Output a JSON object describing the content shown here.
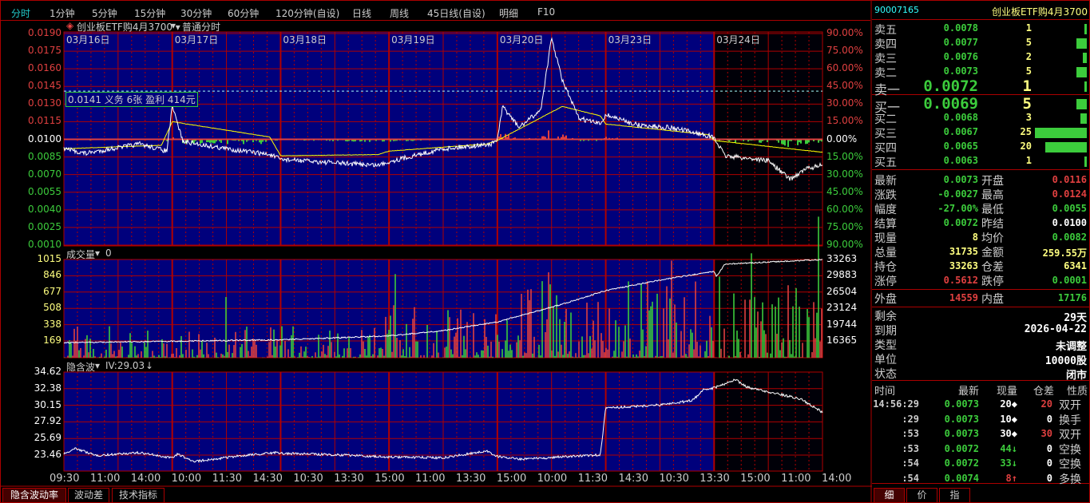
{
  "toolbar": {
    "items": [
      "分时",
      "1分钟",
      "5分钟",
      "15分钟",
      "30分钟",
      "60分钟",
      "120分钟(自设)",
      "日线",
      "周线",
      "45日线(自设)",
      "明细",
      "F10"
    ],
    "active": 0
  },
  "main_chart": {
    "instrument": "创业板ETF购4月3700",
    "mode": "普通分时",
    "dates": [
      "03月16日",
      "03月17日",
      "03月18日",
      "03月19日",
      "03月20日",
      "03月23日",
      "03月24日"
    ],
    "left_ticks": [
      "0.0190",
      "0.0175",
      "0.0160",
      "0.0145",
      "0.0130",
      "0.0115",
      "0.0100",
      "0.0085",
      "0.0070",
      "0.0055",
      "0.0040",
      "0.0025",
      "0.0010"
    ],
    "right_ticks": [
      "90.00%",
      "75.00%",
      "60.00%",
      "45.00%",
      "30.00%",
      "15.00%",
      "0.00%",
      "15.00%",
      "30.00%",
      "45.00%",
      "60.00%",
      "75.00%",
      "90.00%"
    ],
    "info_box": "0.0141 义务  6张  盈利  414元",
    "price_range": [
      0.001,
      0.019
    ],
    "prev_settle": 0.01,
    "price_line": [
      [
        0,
        0.0092
      ],
      [
        0.2,
        0.0088
      ],
      [
        0.5,
        0.0093
      ],
      [
        0.7,
        0.0096
      ],
      [
        0.95,
        0.009
      ],
      [
        1.0,
        0.0128
      ],
      [
        1.1,
        0.0098
      ],
      [
        1.5,
        0.0092
      ],
      [
        1.9,
        0.0087
      ],
      [
        2.0,
        0.0083
      ],
      [
        2.5,
        0.008
      ],
      [
        2.9,
        0.0078
      ],
      [
        3.0,
        0.0081
      ],
      [
        3.5,
        0.0092
      ],
      [
        3.95,
        0.0096
      ],
      [
        4.0,
        0.01
      ],
      [
        4.05,
        0.0128
      ],
      [
        4.2,
        0.011
      ],
      [
        4.4,
        0.0125
      ],
      [
        4.5,
        0.0186
      ],
      [
        4.6,
        0.015
      ],
      [
        4.75,
        0.0118
      ],
      [
        4.95,
        0.0113
      ],
      [
        5.0,
        0.0121
      ],
      [
        5.3,
        0.0112
      ],
      [
        5.6,
        0.011
      ],
      [
        5.95,
        0.0103
      ],
      [
        6.0,
        0.0101
      ],
      [
        6.1,
        0.0086
      ],
      [
        6.5,
        0.0082
      ],
      [
        6.7,
        0.0066
      ],
      [
        6.85,
        0.0075
      ],
      [
        7.0,
        0.0078
      ]
    ],
    "avg_line": [
      [
        0,
        0.0092
      ],
      [
        0.9,
        0.0095
      ],
      [
        1.0,
        0.0115
      ],
      [
        1.9,
        0.0102
      ],
      [
        2.0,
        0.0086
      ],
      [
        2.9,
        0.0087
      ],
      [
        3.0,
        0.009
      ],
      [
        3.9,
        0.0096
      ],
      [
        4.0,
        0.0099
      ],
      [
        4.6,
        0.0128
      ],
      [
        4.95,
        0.012
      ],
      [
        5.0,
        0.0113
      ],
      [
        5.95,
        0.0104
      ],
      [
        6.0,
        0.0099
      ],
      [
        7.0,
        0.0089
      ]
    ]
  },
  "volume_chart": {
    "label": "成交量",
    "value": "0",
    "left_ticks": [
      "1015",
      "846",
      "677",
      "508",
      "338",
      "169"
    ],
    "right_ticks": [
      "33263",
      "29883",
      "26504",
      "23124",
      "19744",
      "16365"
    ],
    "oi_line": [
      [
        0,
        16000
      ],
      [
        1,
        16300
      ],
      [
        2,
        16600
      ],
      [
        3,
        17400
      ],
      [
        3.5,
        18500
      ],
      [
        4,
        20300
      ],
      [
        4.6,
        24000
      ],
      [
        5,
        26800
      ],
      [
        5.5,
        29000
      ],
      [
        6,
        30800
      ],
      [
        6.02,
        29700
      ],
      [
        6.1,
        32300
      ],
      [
        7,
        33263
      ]
    ]
  },
  "iv_chart": {
    "label": "隐含波",
    "iv": "IV:29.03",
    "left_ticks": [
      "34.62",
      "32.38",
      "30.15",
      "27.92",
      "25.69",
      "23.46"
    ],
    "iv_line": [
      [
        0,
        23.6
      ],
      [
        0.1,
        24.4
      ],
      [
        0.3,
        23.4
      ],
      [
        0.7,
        23.8
      ],
      [
        0.95,
        23.2
      ],
      [
        1.0,
        23.1
      ],
      [
        1.05,
        23.6
      ],
      [
        1.2,
        22.6
      ],
      [
        1.6,
        23.3
      ],
      [
        1.95,
        23.8
      ],
      [
        2.0,
        23.7
      ],
      [
        2.5,
        23.5
      ],
      [
        3.0,
        23.2
      ],
      [
        3.5,
        23.1
      ],
      [
        3.9,
        24.0
      ],
      [
        4.0,
        23.3
      ],
      [
        4.2,
        22.9
      ],
      [
        4.95,
        23.5
      ],
      [
        5.0,
        29.8
      ],
      [
        5.5,
        30.2
      ],
      [
        5.8,
        30.8
      ],
      [
        5.9,
        32.2
      ],
      [
        6.0,
        32.5
      ],
      [
        6.2,
        33.6
      ],
      [
        6.3,
        32.6
      ],
      [
        6.8,
        31.0
      ],
      [
        7.0,
        29.2
      ]
    ]
  },
  "time_axis": [
    "09:30",
    "11:00",
    "14:00",
    "10:00",
    "11:30",
    "14:30",
    "10:30",
    "13:30",
    "15:00",
    "11:00",
    "13:30",
    "15:00",
    "10:00",
    "11:30",
    "14:30",
    "10:30",
    "13:30",
    "15:00",
    "11:00",
    "14:00"
  ],
  "bottom_tabs": [
    "隐含波动率",
    "波动差",
    "技术指标"
  ],
  "quote": {
    "code": "90007165",
    "name": "创业板ETF购4月3700",
    "asks": [
      {
        "label": "卖五",
        "price": "0.0078",
        "vol": "1",
        "bar": 1
      },
      {
        "label": "卖四",
        "price": "0.0077",
        "vol": "5",
        "bar": 5
      },
      {
        "label": "卖三",
        "price": "0.0076",
        "vol": "2",
        "bar": 2
      },
      {
        "label": "卖二",
        "price": "0.0073",
        "vol": "5",
        "bar": 5
      },
      {
        "label": "卖一",
        "price": "0.0072",
        "vol": "1",
        "bar": 1
      }
    ],
    "bids": [
      {
        "label": "买一",
        "price": "0.0069",
        "vol": "5",
        "bar": 5
      },
      {
        "label": "买二",
        "price": "0.0068",
        "vol": "3",
        "bar": 3
      },
      {
        "label": "买三",
        "price": "0.0067",
        "vol": "25",
        "bar": 25
      },
      {
        "label": "买四",
        "price": "0.0065",
        "vol": "20",
        "bar": 20
      },
      {
        "label": "买五",
        "price": "0.0063",
        "vol": "1",
        "bar": 1
      }
    ],
    "stats": [
      [
        "最新",
        "0.0073",
        "grn",
        "开盘",
        "0.0116",
        "red"
      ],
      [
        "涨跌",
        "-0.0027",
        "grn",
        "最高",
        "0.0124",
        "red"
      ],
      [
        "幅度",
        "-27.00%",
        "grn",
        "最低",
        "0.0055",
        "grn"
      ],
      [
        "结算",
        "0.0072",
        "grn",
        "昨结",
        "0.0100",
        "wht"
      ],
      [
        "现量",
        "8",
        "yel",
        "均价",
        "0.0082",
        "grn"
      ],
      [
        "总量",
        "31735",
        "yel",
        "金额",
        "259.55万",
        "yel"
      ],
      [
        "持仓",
        "33263",
        "yel",
        "仓差",
        "6341",
        "yel"
      ],
      [
        "涨停",
        "0.5612",
        "red",
        "跌停",
        "0.0001",
        "grn"
      ]
    ],
    "outer": {
      "label": "外盘",
      "value": "14559",
      "inner_label": "内盘",
      "inner_value": "17176"
    },
    "info": [
      [
        "剩余",
        "29天"
      ],
      [
        "到期",
        "2026-04-22"
      ],
      [
        "类型",
        "未调整"
      ],
      [
        "单位",
        "10000股"
      ],
      [
        "状态",
        "闭市"
      ]
    ],
    "trade_headers": [
      "时间",
      "最新",
      "现量",
      "仓差",
      "性质"
    ],
    "trades": [
      [
        "14:56:29",
        "0.0073",
        "20◆",
        "wht",
        "20",
        "red",
        "双开",
        "wht"
      ],
      [
        ":29",
        "0.0073",
        "10◆",
        "wht",
        "0",
        "wht",
        "换手",
        "wht"
      ],
      [
        ":53",
        "0.0073",
        "30◆",
        "wht",
        "30",
        "red",
        "双开",
        "wht"
      ],
      [
        ":53",
        "0.0072",
        "44↓",
        "grn",
        "0",
        "wht",
        "空换",
        "grn"
      ],
      [
        ":54",
        "0.0072",
        "33↓",
        "grn",
        "0",
        "wht",
        "空换",
        "grn"
      ],
      [
        ":54",
        "0.0074",
        "8↑",
        "red",
        "0",
        "wht",
        "多换",
        "red"
      ]
    ],
    "tabs": [
      "细",
      "价",
      "指"
    ]
  },
  "colors": {
    "plot_bg": "#00007c",
    "grid": "#b00000",
    "up": "#e04040",
    "down": "#3ccc3c"
  }
}
